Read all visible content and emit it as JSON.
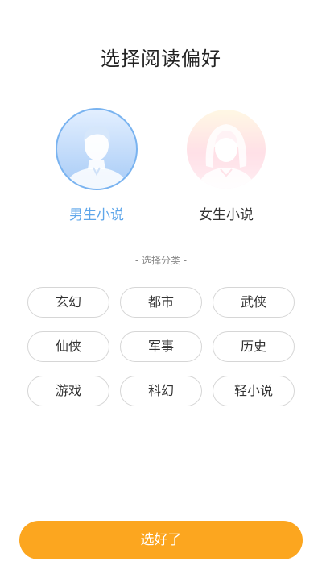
{
  "title": "选择阅读偏好",
  "genders": {
    "male": {
      "label": "男生小说",
      "selected": true,
      "accent": "#5ea6ea"
    },
    "female": {
      "label": "女生小说",
      "selected": false
    }
  },
  "categories_header": "- 选择分类 -",
  "categories": [
    "玄幻",
    "都市",
    "武侠",
    "仙侠",
    "军事",
    "历史",
    "游戏",
    "科幻",
    "轻小说"
  ],
  "confirm_button": {
    "label": "选好了",
    "color": "#fca61f"
  }
}
